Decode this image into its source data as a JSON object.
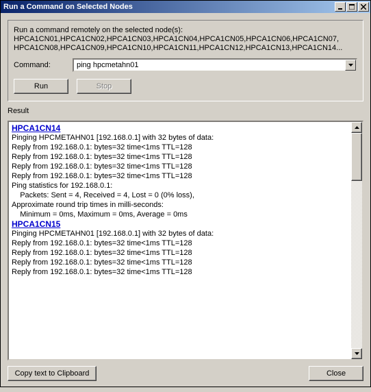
{
  "title": "Run a Command on Selected Nodes",
  "topgroup": {
    "instruction": "Run a command remotely on the selected node(s):",
    "node_line1": "HPCA1CN01,HPCA1CN02,HPCA1CN03,HPCA1CN04,HPCA1CN05,HPCA1CN06,HPCA1CN07,",
    "node_line2": "HPCA1CN08,HPCA1CN09,HPCA1CN10,HPCA1CN11,HPCA1CN12,HPCA1CN13,HPCA1CN14...",
    "command_label": "Command:",
    "command_value": "ping hpcmetahn01",
    "run_label": "Run",
    "stop_label": "Stop"
  },
  "result_label": "Result",
  "result": {
    "h14": "HPCA1CN14",
    "blank": " ",
    "ping14_header": "Pinging HPCMETAHN01 [192.168.0.1] with 32 bytes of data:",
    "reply1": "Reply from 192.168.0.1: bytes=32 time<1ms TTL=128",
    "reply2": "Reply from 192.168.0.1: bytes=32 time<1ms TTL=128",
    "reply3": "Reply from 192.168.0.1: bytes=32 time<1ms TTL=128",
    "reply4": "Reply from 192.168.0.1: bytes=32 time<1ms TTL=128",
    "stats_hdr": "Ping statistics for 192.168.0.1:",
    "stats_pkts": "    Packets: Sent = 4, Received = 4, Lost = 0 (0% loss),",
    "rt_hdr": "Approximate round trip times in milli-seconds:",
    "rt_vals": "    Minimum = 0ms, Maximum = 0ms, Average = 0ms",
    "h15": "HPCA1CN15",
    "ping15_header": "Pinging HPCMETAHN01 [192.168.0.1] with 32 bytes of data:",
    "reply5": "Reply from 192.168.0.1: bytes=32 time<1ms TTL=128",
    "reply6": "Reply from 192.168.0.1: bytes=32 time<1ms TTL=128",
    "reply7": "Reply from 192.168.0.1: bytes=32 time<1ms TTL=128",
    "reply8": "Reply from 192.168.0.1: bytes=32 time<1ms TTL=128"
  },
  "bottom": {
    "copy_label": "Copy text to Clipboard",
    "close_label": "Close"
  }
}
